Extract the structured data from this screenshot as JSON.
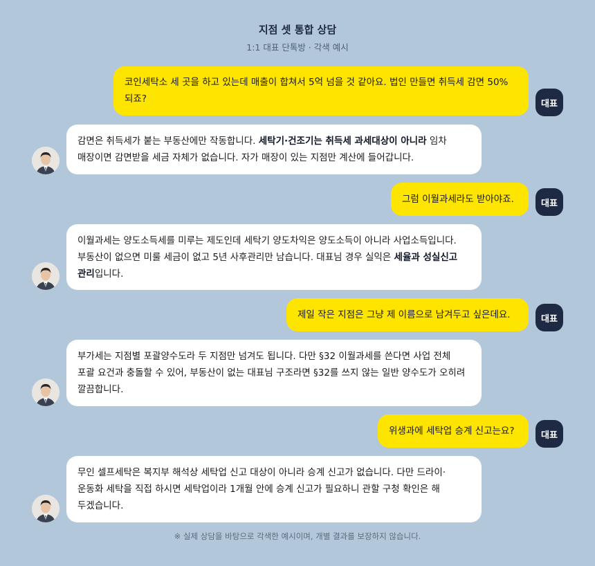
{
  "header": {
    "title": "지점 셋 통합 상담",
    "subtitle": "1:1 대표 단톡방 · 각색 예시"
  },
  "badge_label": "대표",
  "avatar_icon": "advisor-avatar",
  "colors": {
    "background": "#b2c7da",
    "user_bubble": "#fee500",
    "bot_bubble": "#ffffff",
    "badge": "#1e2a44"
  },
  "messages": [
    {
      "role": "user",
      "text": "코인세탁소 세 곳을 하고 있는데 매출이 합쳐서 5억 넘을 것 같아요. 법인 만들면 취득세 감면 50% 되죠?"
    },
    {
      "role": "advisor",
      "text_before": "감면은 취득세가 붙는 부동산에만 작동합니다. ",
      "bold": "세탁기·건조기는 취득세 과세대상이 아니라",
      "text_after": " 임차 매장이면 감면받을 세금 자체가 없습니다. 자가 매장이 있는 지점만 계산에 들어갑니다."
    },
    {
      "role": "user",
      "text": "그럼 이월과세라도 받아야죠."
    },
    {
      "role": "advisor",
      "text_before": "이월과세는 양도소득세를 미루는 제도인데 세탁기 양도차익은 양도소득이 아니라 사업소득입니다. 부동산이 없으면 미룰 세금이 없고 5년 사후관리만 남습니다. 대표님 경우 실익은 ",
      "bold": "세율과 성실신고 관리",
      "text_after": "입니다."
    },
    {
      "role": "user",
      "text": "제일 작은 지점은 그냥 제 이름으로 남겨두고 싶은데요."
    },
    {
      "role": "advisor",
      "text_before": "부가세는 지점별 포괄양수도라 두 지점만 넘겨도 됩니다. 다만 §32 이월과세를 쓴다면 사업 전체 포괄 요건과 충돌할 수 있어, 부동산이 없는 대표님 구조라면 §32를 쓰지 않는 일반 양수도가 오히려 깔끔합니다.",
      "bold": "",
      "text_after": ""
    },
    {
      "role": "user",
      "text": "위생과에 세탁업 승계 신고는요?"
    },
    {
      "role": "advisor",
      "text_before": "무인 셀프세탁은 복지부 해석상 세탁업 신고 대상이 아니라 승계 신고가 없습니다. 다만 드라이·운동화 세탁을 직접 하시면 세탁업이라 1개월 안에 승계 신고가 필요하니 관할 구청 확인은 해 두겠습니다.",
      "bold": "",
      "text_after": ""
    }
  ],
  "footer": "※ 실제 상담을 바탕으로 각색한 예시이며, 개별 결과를 보장하지 않습니다."
}
